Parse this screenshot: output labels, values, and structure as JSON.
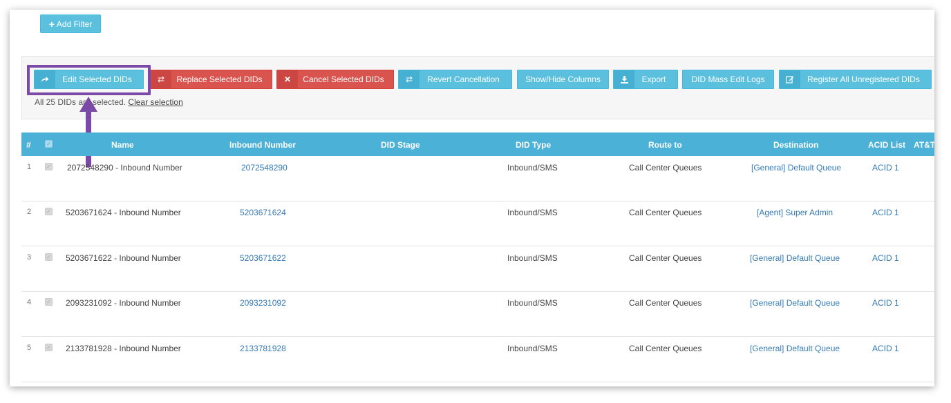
{
  "add_filter": {
    "icon": "plus-icon",
    "label": "Add Filter"
  },
  "toolbar": {
    "buttons": [
      {
        "label": "Edit Selected DIDs",
        "icon": "share-icon",
        "color": "#5bc0de"
      },
      {
        "label": "Replace Selected DIDs",
        "icon": "retweet-icon",
        "color": "#d9534f"
      },
      {
        "label": "Cancel Selected DIDs",
        "icon": "close-icon",
        "color": "#d9534f"
      },
      {
        "label": "Revert Cancellation",
        "icon": "retweet-icon",
        "color": "#5bc0de"
      },
      {
        "label": "Show/Hide Columns",
        "icon": "",
        "color": "#5bc0de"
      },
      {
        "label": "Export",
        "icon": "download-icon",
        "color": "#5bc0de"
      },
      {
        "label": "DID Mass Edit Logs",
        "icon": "",
        "color": "#5bc0de"
      },
      {
        "label": "Register All Unregistered DIDs",
        "icon": "edit-icon",
        "color": "#5bc0de"
      }
    ],
    "selection_text_prefix": "All 25 DIDs are selected.",
    "clear_selection": "Clear selection"
  },
  "highlight_color": "#7b4aa6",
  "table": {
    "header_color": "#4bb1d6",
    "columns": [
      "#",
      "",
      "Name",
      "Inbound Number",
      "DID Stage",
      "DID Type",
      "Route to",
      "Destination",
      "ACID List",
      "AT&T"
    ],
    "rows": [
      {
        "num": "1",
        "name": "2072548290 - Inbound Number",
        "inbound": "2072548290",
        "stage": "",
        "type": "Inbound/SMS",
        "route": "Call Center Queues",
        "destination": "[General] Default Queue",
        "acid": "ACID 1"
      },
      {
        "num": "2",
        "name": "5203671624 - Inbound Number",
        "inbound": "5203671624",
        "stage": "",
        "type": "Inbound/SMS",
        "route": "Call Center Queues",
        "destination": "[Agent] Super Admin",
        "acid": "ACID 1"
      },
      {
        "num": "3",
        "name": "5203671622 - Inbound Number",
        "inbound": "5203671622",
        "stage": "",
        "type": "Inbound/SMS",
        "route": "Call Center Queues",
        "destination": "[General] Default Queue",
        "acid": "ACID 1"
      },
      {
        "num": "4",
        "name": "2093231092 - Inbound Number",
        "inbound": "2093231092",
        "stage": "",
        "type": "Inbound/SMS",
        "route": "Call Center Queues",
        "destination": "[General] Default Queue",
        "acid": "ACID 1"
      },
      {
        "num": "5",
        "name": "2133781928 - Inbound Number",
        "inbound": "2133781928",
        "stage": "",
        "type": "Inbound/SMS",
        "route": "Call Center Queues",
        "destination": "[General] Default Queue",
        "acid": "ACID 1"
      }
    ]
  }
}
